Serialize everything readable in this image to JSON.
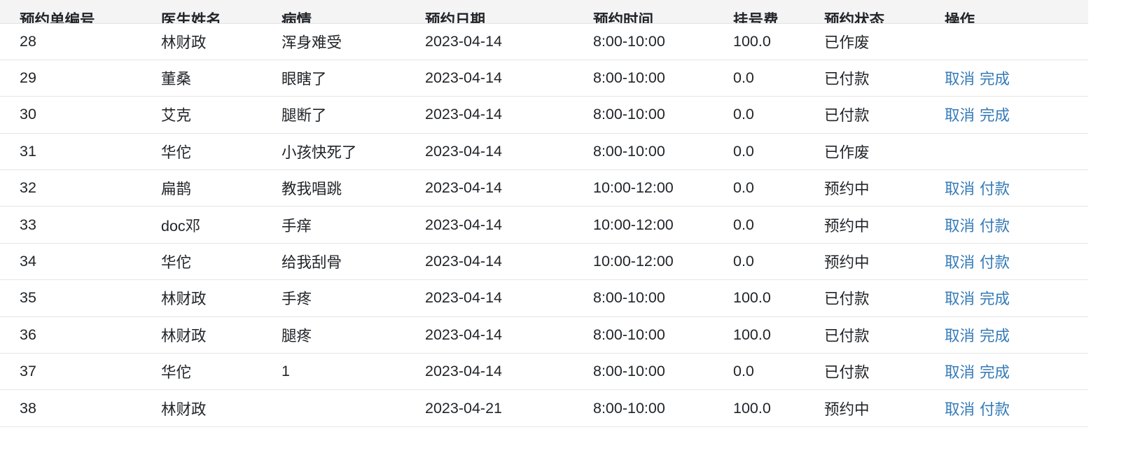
{
  "table": {
    "columns": [
      {
        "key": "id",
        "label": "预约单编号"
      },
      {
        "key": "doctor",
        "label": "医生姓名"
      },
      {
        "key": "condition",
        "label": "病情"
      },
      {
        "key": "date",
        "label": "预约日期"
      },
      {
        "key": "time",
        "label": "预约时间"
      },
      {
        "key": "fee",
        "label": "挂号费"
      },
      {
        "key": "status",
        "label": "预约状态"
      },
      {
        "key": "action",
        "label": "操作"
      }
    ],
    "rows": [
      {
        "id": "28",
        "doctor": "林财政",
        "condition": "浑身难受",
        "date": "2023-04-14",
        "time": "8:00-10:00",
        "fee": "100.0",
        "status": "已作废",
        "actions": []
      },
      {
        "id": "29",
        "doctor": "董桑",
        "condition": "眼瞎了",
        "date": "2023-04-14",
        "time": "8:00-10:00",
        "fee": "0.0",
        "status": "已付款",
        "actions": [
          "取消",
          "完成"
        ]
      },
      {
        "id": "30",
        "doctor": "艾克",
        "condition": "腿断了",
        "date": "2023-04-14",
        "time": "8:00-10:00",
        "fee": "0.0",
        "status": "已付款",
        "actions": [
          "取消",
          "完成"
        ]
      },
      {
        "id": "31",
        "doctor": "华佗",
        "condition": "小孩快死了",
        "date": "2023-04-14",
        "time": "8:00-10:00",
        "fee": "0.0",
        "status": "已作废",
        "actions": []
      },
      {
        "id": "32",
        "doctor": "扁鹊",
        "condition": "教我唱跳",
        "date": "2023-04-14",
        "time": "10:00-12:00",
        "fee": "0.0",
        "status": "预约中",
        "actions": [
          "取消",
          "付款"
        ]
      },
      {
        "id": "33",
        "doctor": "doc邓",
        "condition": "手痒",
        "date": "2023-04-14",
        "time": "10:00-12:00",
        "fee": "0.0",
        "status": "预约中",
        "actions": [
          "取消",
          "付款"
        ]
      },
      {
        "id": "34",
        "doctor": "华佗",
        "condition": "给我刮骨",
        "date": "2023-04-14",
        "time": "10:00-12:00",
        "fee": "0.0",
        "status": "预约中",
        "actions": [
          "取消",
          "付款"
        ]
      },
      {
        "id": "35",
        "doctor": "林财政",
        "condition": "手疼",
        "date": "2023-04-14",
        "time": "8:00-10:00",
        "fee": "100.0",
        "status": "已付款",
        "actions": [
          "取消",
          "完成"
        ]
      },
      {
        "id": "36",
        "doctor": "林财政",
        "condition": "腿疼",
        "date": "2023-04-14",
        "time": "8:00-10:00",
        "fee": "100.0",
        "status": "已付款",
        "actions": [
          "取消",
          "完成"
        ]
      },
      {
        "id": "37",
        "doctor": "华佗",
        "condition": "1",
        "date": "2023-04-14",
        "time": "8:00-10:00",
        "fee": "0.0",
        "status": "已付款",
        "actions": [
          "取消",
          "完成"
        ]
      },
      {
        "id": "38",
        "doctor": "林财政",
        "condition": "",
        "date": "2023-04-21",
        "time": "8:00-10:00",
        "fee": "100.0",
        "status": "预约中",
        "actions": [
          "取消",
          "付款"
        ]
      }
    ]
  },
  "colors": {
    "link": "#337ab7",
    "header_background": "#f4f4f5",
    "row_border": "#e6e6e7",
    "text": "#212529"
  }
}
